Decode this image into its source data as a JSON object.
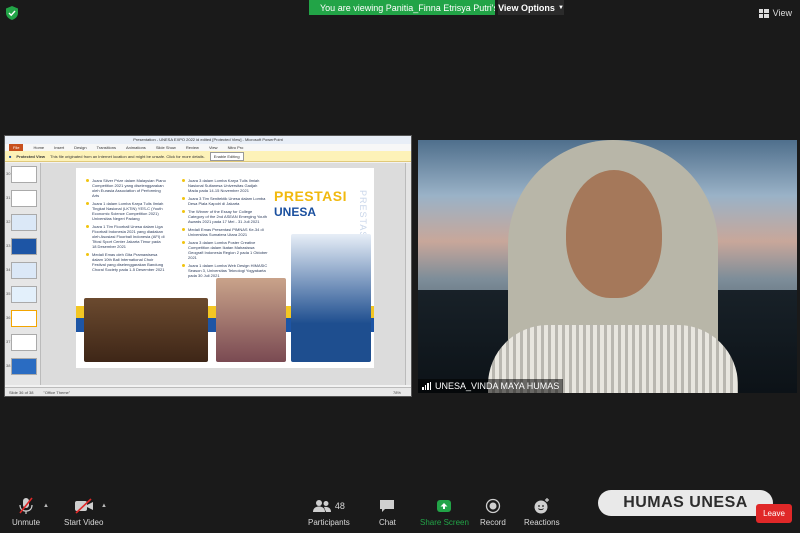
{
  "top_bar": {
    "share_banner": "You are viewing Panitia_Finna Etrisya Putri's screen",
    "view_options": "View Options",
    "view_label": "View"
  },
  "presentation": {
    "window_title": "Presentation - UNESA EXPO 2022 id edited [Protected View] - Microsoft PowerPoint",
    "menu": [
      "File",
      "Home",
      "Insert",
      "Design",
      "Transitions",
      "Animations",
      "Slide Show",
      "Review",
      "View",
      "Nitro Pro"
    ],
    "protected_view_label": "Protected View",
    "protected_view_message": "This file originated from an Internet location and might be unsafe. Click for more details.",
    "enable_editing": "Enable Editing",
    "status_slide": "Slide 36 of 38",
    "status_theme": "\"Office Theme\"",
    "status_zoom": "78%",
    "thumb_numbers": [
      "30",
      "31",
      "32",
      "33",
      "34",
      "35",
      "36",
      "37",
      "38"
    ]
  },
  "slide": {
    "heading_1": "PRESTASI",
    "heading_2": "UNESA",
    "vertical_text": "PRESTASI",
    "achievements_left": [
      "Juara Silver Prize dalam Malaysian Piano Competition 2021 yang diselenggarakan oleh Eurasia Association of Performing Arts",
      "Juara 1 dalam Lomba Karya Tulis Ilmiah Tingkat Nasional (LKTIN) YES-C (Youth Economic Science Competition 2021) Universitas Negeri Padang",
      "Juara 1 Tim Floorball Unesa dalam Liga Floorball Indonesia 2021 yang diadakan oleh Asosiasi Floorball Indonesia (AFI) di Tifosi Sport Center Jakarta Timur pada 18 Desember 2021",
      "Medali Emas oleh Gita Pramawisesa dalam 10th Bali International Choir Festival yang diselenggarakan Bandung Choral Society pada 1-5 Desember 2021"
    ],
    "achievements_right": [
      "Juara 3 dalam Lomba Karya Tulis Ilmiah Nasional Sultanesa Universitas Gadjah Mada pada 14-15 November 2021",
      "Juara 3 Tim Senitektik Unesa dalam Lomba Desa Piala Kapolri di Jakarta",
      "The Winner of the Essay for College Category of the 2nd ASEAN Emerging Youth Awards 2021 pada 17 Mei - 31 Juli 2021",
      "Medali Emas Presentasi PIMNAS Ke-34 di Universitas Sumatera Utara 2021",
      "Juara 3 dalam Lomba Poster Creative Competition dalam Ikatan Mahasiswa Geografi Indonesia Region 2 pada 1 Oktober 2021",
      "Juara 1 dalam Lomba Web Design HIMASIC Season 3, Universitas Teknologi Yogyakarta pada 30 Juli 2021"
    ]
  },
  "camera": {
    "participant_name": "UNESA_VINDA MAYA HUMAS"
  },
  "toolbar": {
    "unmute": "Unmute",
    "start_video": "Start Video",
    "participants": "Participants",
    "participants_count": "48",
    "chat": "Chat",
    "share_screen": "Share Screen",
    "record": "Record",
    "reactions": "Reactions",
    "leave": "Leave"
  },
  "watermark": {
    "text": "HUMAS UNESA"
  },
  "colors": {
    "share_green": "#22a447",
    "leave_red": "#e02828",
    "unesa_yellow": "#f1b90f",
    "unesa_blue": "#1a4f9e"
  }
}
